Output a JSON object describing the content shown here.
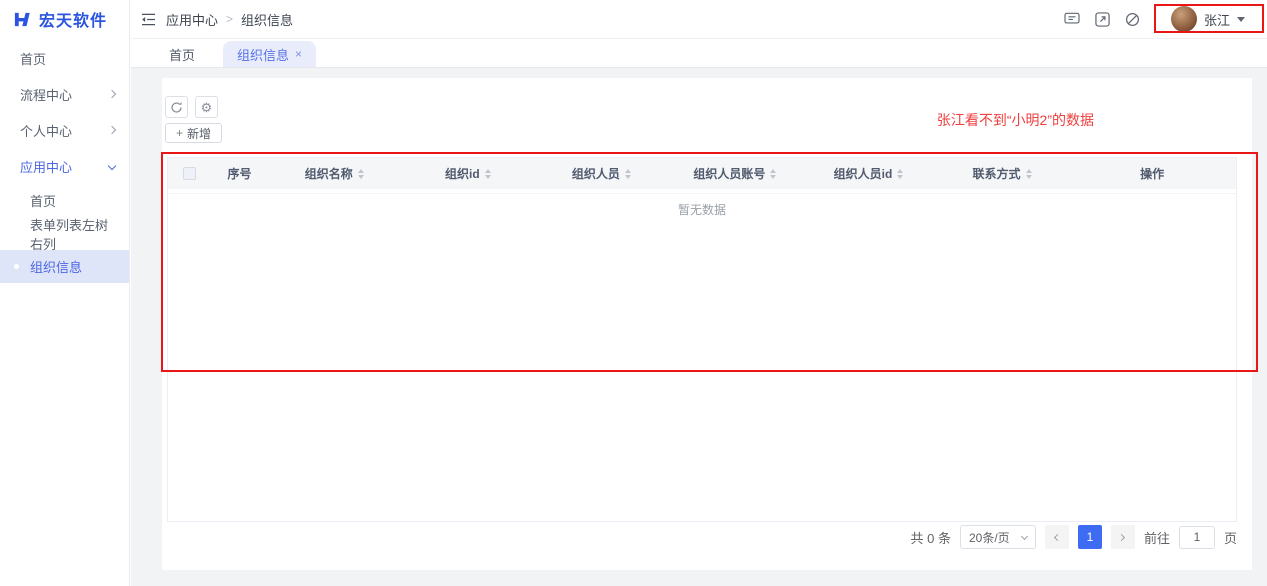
{
  "brand": {
    "name": "宏天软件"
  },
  "sidebar": {
    "items": [
      {
        "label": "首页"
      },
      {
        "label": "流程中心"
      },
      {
        "label": "个人中心"
      },
      {
        "label": "应用中心"
      },
      {
        "label": "首页"
      },
      {
        "label": "表单列表左树右列"
      },
      {
        "label": "组织信息"
      }
    ]
  },
  "header": {
    "breadcrumb": {
      "section": "应用中心",
      "separator": ">",
      "page": "组织信息"
    },
    "user": {
      "name": "张江"
    }
  },
  "tabs": [
    {
      "label": "首页"
    },
    {
      "label": "组织信息"
    }
  ],
  "icons": {
    "close": "×",
    "plus": "+",
    "gear": "⚙"
  },
  "toolbar": {
    "add_label": "新增"
  },
  "annotation": {
    "text": "张江看不到“小明2”的数据"
  },
  "table": {
    "columns": [
      "序号",
      "组织名称",
      "组织id",
      "组织人员",
      "组织人员账号",
      "组织人员id",
      "联系方式",
      "操作"
    ],
    "empty_text": "暂无数据"
  },
  "pagination": {
    "total": "共 0 条",
    "page_size": "20条/页",
    "current_page": "1",
    "goto_prefix": "前往",
    "goto_value": "1",
    "goto_suffix": "页"
  }
}
